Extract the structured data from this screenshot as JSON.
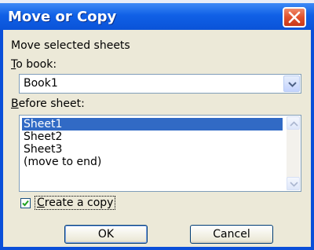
{
  "window": {
    "title": "Move or Copy"
  },
  "body": {
    "heading": "Move selected sheets",
    "to_book_label": "To book:",
    "to_book_value": "Book1",
    "before_sheet_label": "Before sheet:",
    "sheets": [
      "Sheet1",
      "Sheet2",
      "Sheet3",
      "(move to end)"
    ],
    "selected_sheet": "Sheet1",
    "create_copy_label": "Create a copy",
    "create_copy_checked": true
  },
  "buttons": {
    "ok_label": "OK",
    "cancel_label": "Cancel"
  },
  "colors": {
    "title_bar": "#1060e6",
    "close_button": "#e2512c",
    "selection": "#316ac5",
    "dialog_face": "#ece9d8"
  },
  "icons": [
    "close-icon",
    "chevron-down-icon",
    "scroll-up-icon",
    "scroll-down-icon",
    "checkmark-icon"
  ]
}
